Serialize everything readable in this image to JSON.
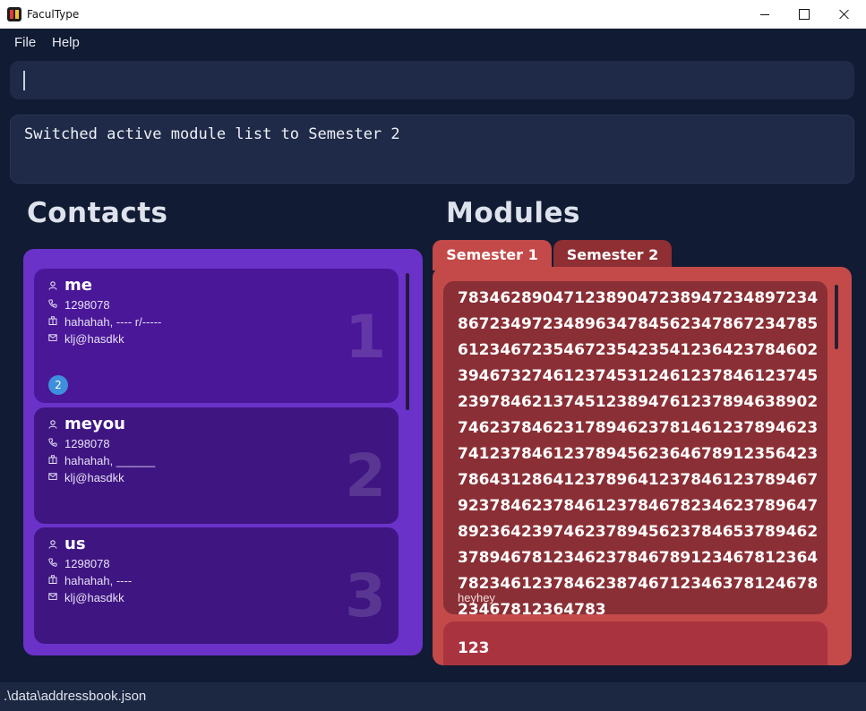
{
  "window": {
    "title": "FaculType"
  },
  "menu": {
    "file": "File",
    "help": "Help"
  },
  "command": {
    "value": ""
  },
  "result": {
    "text": "Switched active module list to Semester 2"
  },
  "contacts": {
    "title": "Contacts",
    "items": [
      {
        "index": "1",
        "name": "me",
        "phone": "1298078",
        "address": "hahahah, ---- r/-----",
        "email": "klj@hasdkk",
        "tag": "2"
      },
      {
        "index": "2",
        "name": "meyou",
        "phone": "1298078",
        "address": "hahahah, ______",
        "email": "klj@hasdkk"
      },
      {
        "index": "3",
        "name": "us",
        "phone": "1298078",
        "address": "hahahah, ----",
        "email": "klj@hasdkk"
      }
    ]
  },
  "modules": {
    "title": "Modules",
    "tabs": [
      {
        "label": "Semester 1",
        "active": true
      },
      {
        "label": "Semester 2",
        "active": false
      }
    ],
    "items": [
      {
        "code": "78346289047123890472389472348972348672349723489634784562347867234785612346723546723542354123642378460239467327461237453124612378461237452397846213745123894761237894638902746237846231789462378146123789462374123784612378945623646789123564237864312864123789641237846123789467923784623784612378467823462378964789236423974623789456237846537894623789467812346237846789123467812364782346123784623874671234637812467823467812364783",
        "description": "heyhey"
      },
      {
        "code": "123",
        "description": ""
      }
    ]
  },
  "status": {
    "path": ".\\data\\addressbook.json"
  },
  "colors": {
    "background": "#111b33",
    "contacts_panel": "#6a32c9",
    "modules_panel": "#c44a4a",
    "module_card": "#8a2f35",
    "tag": "#3f8fdc"
  }
}
